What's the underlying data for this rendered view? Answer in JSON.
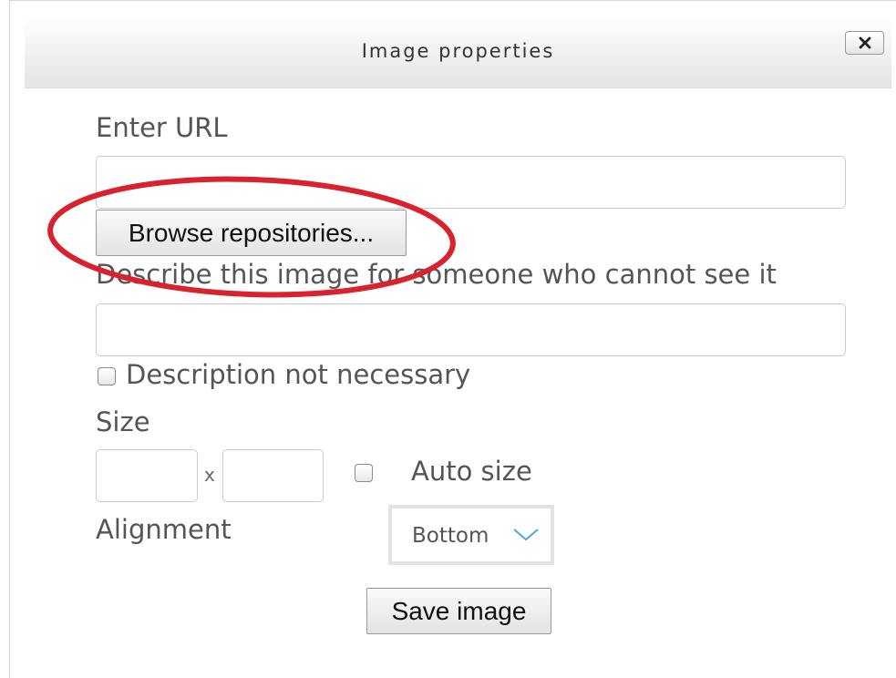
{
  "dialog": {
    "title": "Image properties",
    "close_icon": "close-icon"
  },
  "url_field": {
    "label": "Enter URL",
    "value": ""
  },
  "browse_button": {
    "label": "Browse repositories..."
  },
  "description": {
    "label": "Describe this image for someone who cannot see it",
    "value": "",
    "not_necessary_label": "Description not necessary",
    "not_necessary_checked": false
  },
  "size": {
    "label": "Size",
    "width_value": "",
    "height_value": "",
    "separator": "x",
    "auto_size_label": "Auto size",
    "auto_size_checked": false
  },
  "alignment": {
    "label": "Alignment",
    "selected": "Bottom",
    "chevron_icon": "chevron-down-icon"
  },
  "save_button": {
    "label": "Save image"
  },
  "colors": {
    "annotation_ring": "#d8222e",
    "chevron": "#4aa8e0"
  }
}
